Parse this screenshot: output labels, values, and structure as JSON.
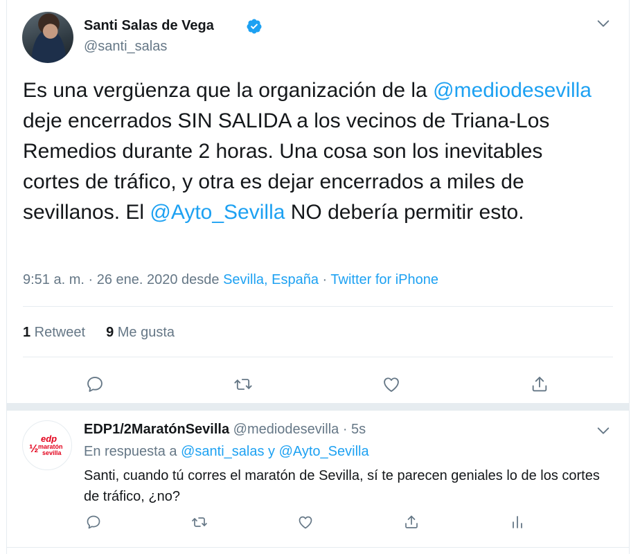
{
  "main_tweet": {
    "author_name": "Santi Salas de Vega",
    "handle": "@santi_salas",
    "text_parts": [
      "Es una vergüenza que la organización de la ",
      "@mediodesevilla",
      " deje encerrados SIN SALIDA a los vecinos de Triana-Los Remedios durante 2 horas. Una cosa son los inevitables cortes de tráfico, y otra es dejar encerrados a miles de sevillanos. El ",
      "@Ayto_Sevilla",
      " NO debería permitir esto."
    ],
    "time": "9:51 a. m. · 26 ene. 2020 desde ",
    "location": "Sevilla, España",
    "meta_sep": " · ",
    "source": "Twitter for iPhone",
    "retweet_count": "1",
    "retweet_label": " Retweet",
    "like_count": "9",
    "like_label": " Me gusta",
    "icons": [
      "reply-icon",
      "retweet-icon",
      "like-icon",
      "share-icon"
    ]
  },
  "reply_tweet": {
    "author_name": "EDP1/2MaratónSevilla",
    "handle": "@mediodesevilla",
    "time_sep": " · ",
    "time": "5s",
    "in_reply_prefix": "En respuesta a ",
    "mention_1": "@santi_salas",
    "joiner": " y ",
    "mention_2": "@Ayto_Sevilla",
    "text": "Santi, cuando tú corres el maratón de Sevilla, sí te parecen geniales lo de los cortes de tráfico, ¿no?",
    "logo_text_top": "edp",
    "logo_text_mid": "maratón",
    "logo_text_bottom": "sevilla",
    "icons": [
      "reply-icon",
      "retweet-icon",
      "like-icon",
      "share-icon",
      "analytics-icon"
    ]
  },
  "colors": {
    "link": "#1da1f2",
    "muted": "#657786",
    "text": "#14171a",
    "border": "#e6ecf0",
    "logo_red": "#e3001b"
  }
}
